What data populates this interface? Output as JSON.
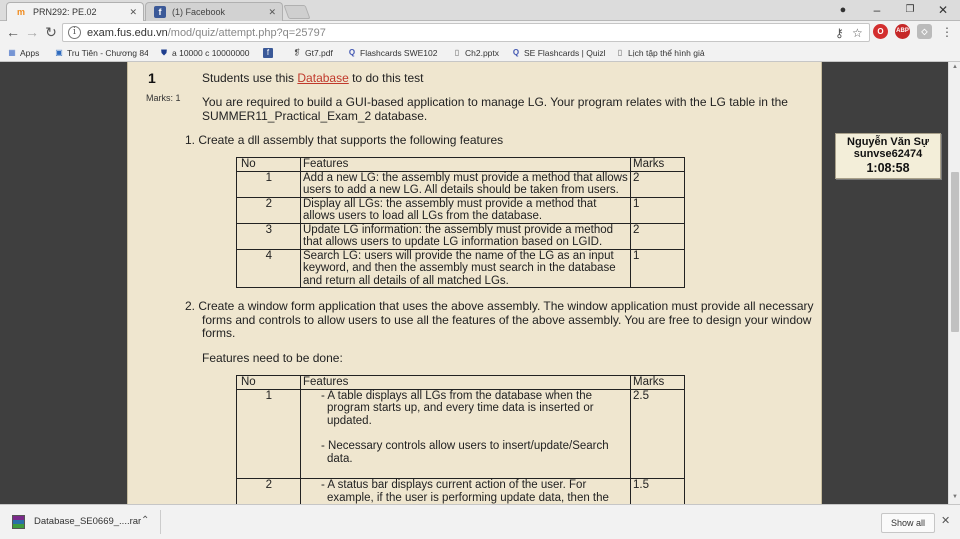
{
  "tabs": [
    {
      "title": "PRN292: PE.02"
    },
    {
      "title": "(1) Facebook"
    }
  ],
  "toolbar": {
    "url_host": "exam.fus.edu.vn",
    "url_path": "/mod/quiz/attempt.php?q=25797"
  },
  "bookmarks": [
    {
      "label": "Apps",
      "icon": "apps-grid-icon"
    },
    {
      "label": "Tru Tiên - Chương 84",
      "icon": "book-icon"
    },
    {
      "label": "a 10000 c 10000000",
      "icon": "shield-icon"
    },
    {
      "label": "",
      "icon": "facebook-icon"
    },
    {
      "label": "Gt7.pdf",
      "icon": "pdf-icon"
    },
    {
      "label": "Flashcards SWE102 -",
      "icon": "quizlet-icon"
    },
    {
      "label": "Ch2.pptx",
      "icon": "doc-icon"
    },
    {
      "label": "SE Flashcards | Quizle",
      "icon": "quizlet-icon"
    },
    {
      "label": "Lịch tập thể hình giả",
      "icon": "doc-icon"
    }
  ],
  "question": {
    "number": "1",
    "marks": "Marks: 1",
    "intro_pre": "Students use this ",
    "intro_link": "Database",
    "intro_post": " to do this test",
    "desc_line1": "You are required to build a GUI-based application to manage LG. Your program relates with the LG table in the",
    "desc_line2": "SUMMER11_Practical_Exam_2 database.",
    "part1_title": "1. Create a dll assembly that supports the following features",
    "table1": {
      "headers": [
        "No",
        "Features",
        "Marks"
      ],
      "rows": [
        {
          "no": "1",
          "lines": [
            "Add a new LG: the assembly must provide a method that allows",
            "users to add a new LG. All details should be taken from users."
          ],
          "marks": "2"
        },
        {
          "no": "2",
          "lines": [
            "Display all LGs: the assembly must provide a method that",
            "allows users to load all LGs from the database."
          ],
          "marks": "1"
        },
        {
          "no": "3",
          "lines": [
            "Update LG information: the assembly must provide a method",
            "that allows users to update LG information based on LGID."
          ],
          "marks": "2"
        },
        {
          "no": "4",
          "lines": [
            "Search LG: users will provide the name of the LG as an input",
            "keyword, and then the assembly must search in the database",
            "and return all details of all matched LGs."
          ],
          "marks": "1"
        }
      ]
    },
    "part2_line1": "2. Create a window form application that uses the above assembly. The window application must provide all necessary",
    "part2_line2": "forms and controls to allow users to use all the features of the above assembly. You are free to design your window",
    "part2_line3": "forms.",
    "features_heading": "Features need to be done:",
    "table2": {
      "headers": [
        "No",
        "Features",
        "Marks"
      ],
      "rows": [
        {
          "no": "1",
          "bullets": [
            [
              "- A table displays all LGs from the database when the",
              "program starts up, and every time data is inserted or",
              "updated."
            ],
            [
              "- Necessary controls allow users to insert/update/Search",
              "data."
            ]
          ],
          "marks": "2.5"
        },
        {
          "no": "2",
          "bullets": [
            [
              "- A status bar displays current action of the user. For",
              "example, if the user is performing update data, then the"
            ]
          ],
          "marks": "1.5"
        }
      ]
    }
  },
  "timer": {
    "name": "Nguyễn Văn Sự",
    "user": "sunvse62474",
    "time": "1:08:58"
  },
  "download": {
    "file": "Database_SE0669_....rar",
    "show_all": "Show all"
  }
}
